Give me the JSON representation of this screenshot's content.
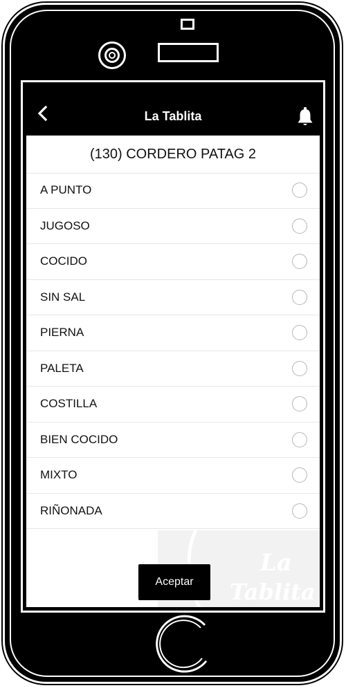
{
  "header": {
    "title": "La Tablita",
    "back_icon": "chevron-left-icon",
    "notification_icon": "bell-icon"
  },
  "product": {
    "title": "(130) CORDERO PATAG 2"
  },
  "options": [
    {
      "label": "A PUNTO",
      "selected": false
    },
    {
      "label": "JUGOSO",
      "selected": false
    },
    {
      "label": "COCIDO",
      "selected": false
    },
    {
      "label": "SIN SAL",
      "selected": false
    },
    {
      "label": "PIERNA",
      "selected": false
    },
    {
      "label": "PALETA",
      "selected": false
    },
    {
      "label": "COSTILLA",
      "selected": false
    },
    {
      "label": "BIEN COCIDO",
      "selected": false
    },
    {
      "label": "MIXTO",
      "selected": false
    },
    {
      "label": "RIÑONADA",
      "selected": false
    }
  ],
  "footer": {
    "accept_label": "Aceptar",
    "watermark_line1": "La",
    "watermark_line2": "Tablita"
  },
  "colors": {
    "header_bg": "#000000",
    "header_text": "#ffffff",
    "radio_border": "#b5b5b5",
    "watermark_bg": "#f2f2f2",
    "watermark_text": "#ffffff"
  }
}
